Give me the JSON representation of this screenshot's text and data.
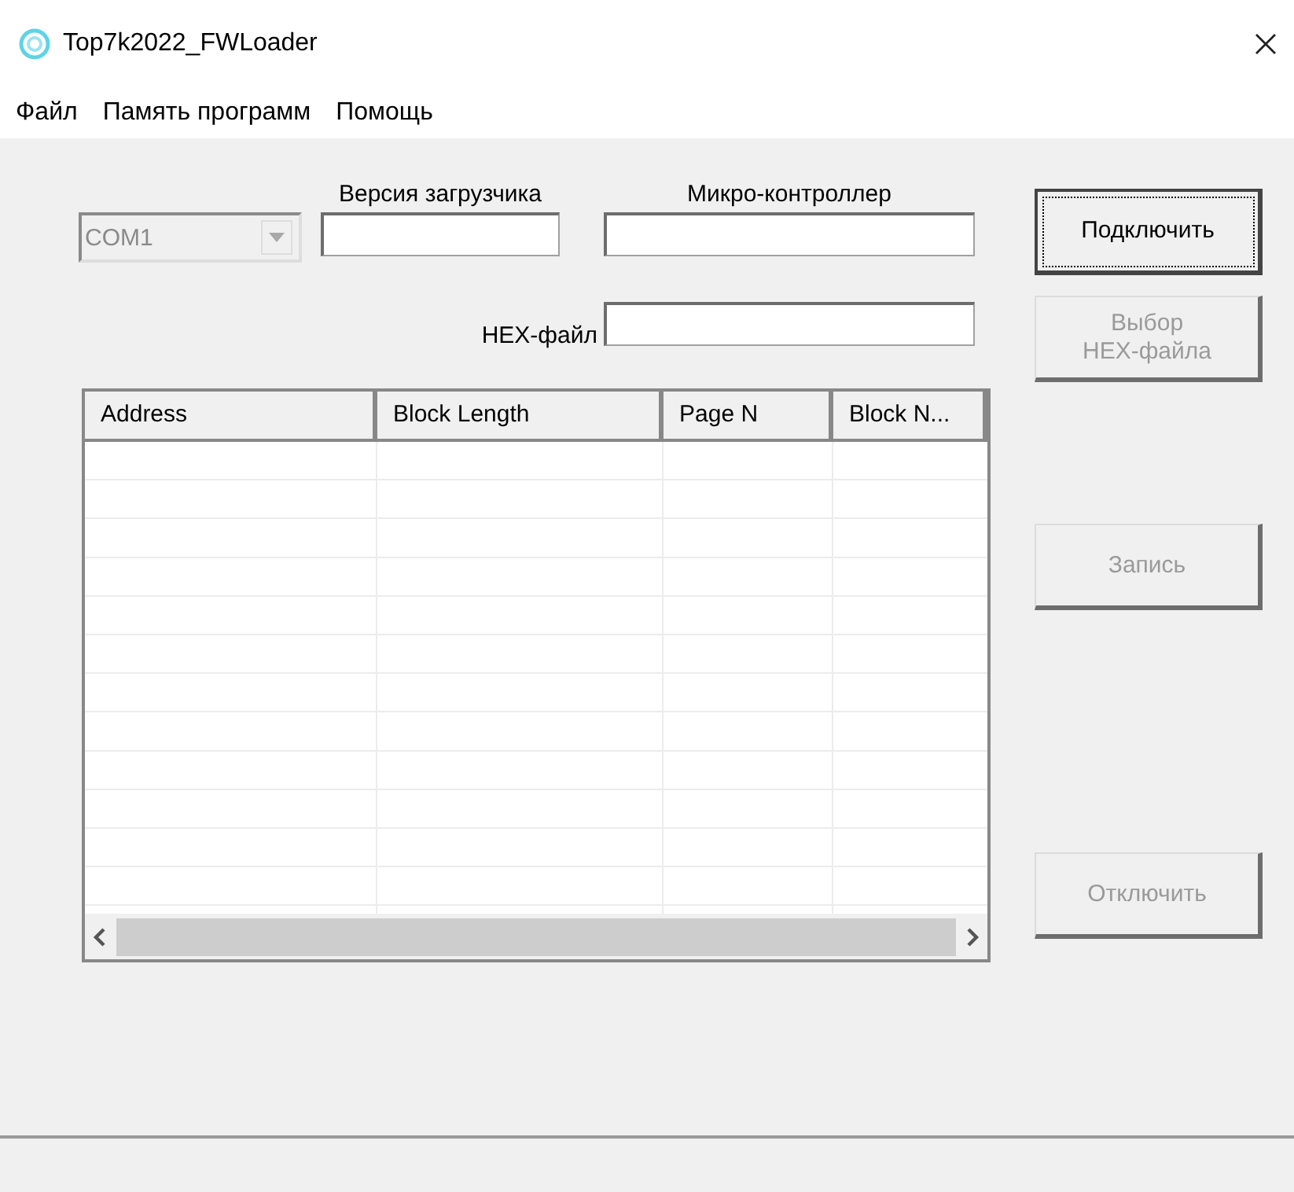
{
  "window": {
    "title": "Top7k2022_FWLoader"
  },
  "menu": [
    "Файл",
    "Память программ",
    "Помощь"
  ],
  "port": {
    "value": "COM1",
    "disabled": true
  },
  "fields": [
    {
      "label": "Версия загрузчика"
    },
    {
      "label": "Микро-контроллер"
    },
    {
      "label": "HEX-файл"
    }
  ],
  "table": {
    "columns": [
      "Address",
      "Block Length",
      "Page N",
      "Block N..."
    ]
  },
  "buttons": [
    {
      "label": "Подключить",
      "disabled": false,
      "focused": true
    },
    {
      "label": "Выбор\nHEX-файла",
      "disabled": true,
      "focused": false
    },
    {
      "label": "Запись",
      "disabled": true,
      "focused": false
    },
    {
      "label": "Отключить",
      "disabled": true,
      "focused": false
    }
  ]
}
